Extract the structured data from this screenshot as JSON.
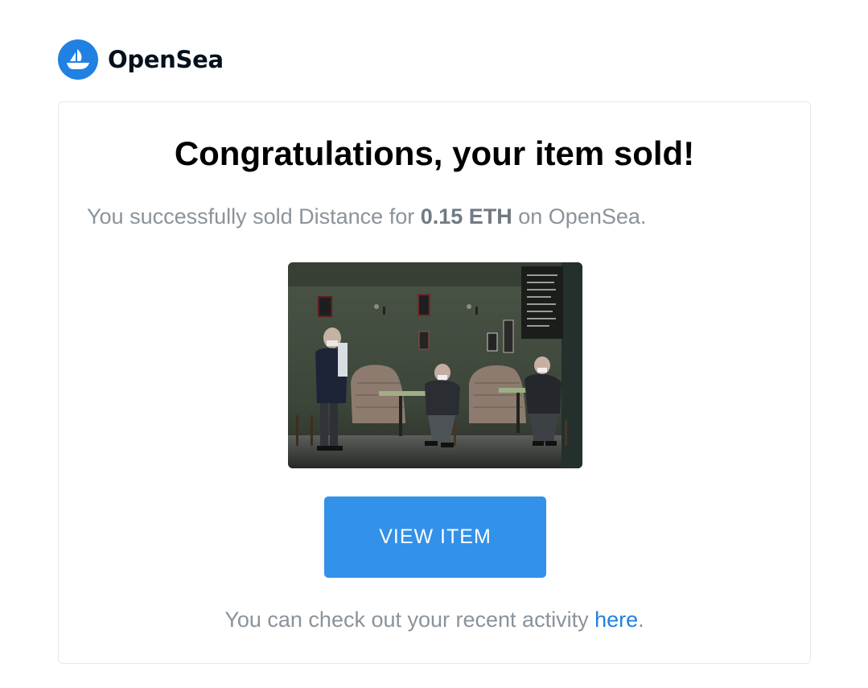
{
  "brand": {
    "name": "OpenSea",
    "icon": "opensea-ship-icon",
    "color": "#2081e2"
  },
  "message": {
    "title": "Congratulations, your item sold!",
    "subtitle_prefix": "You successfully sold Distance for ",
    "price": "0.15 ETH",
    "subtitle_suffix": " on OpenSea."
  },
  "item": {
    "image_alt": "photo-of-men-at-cafe-tables"
  },
  "actions": {
    "view_item_label": "VIEW ITEM",
    "button_color": "#3291e9"
  },
  "footer": {
    "text_prefix": "You can check out your recent activity ",
    "link_label": "here",
    "text_suffix": "."
  }
}
